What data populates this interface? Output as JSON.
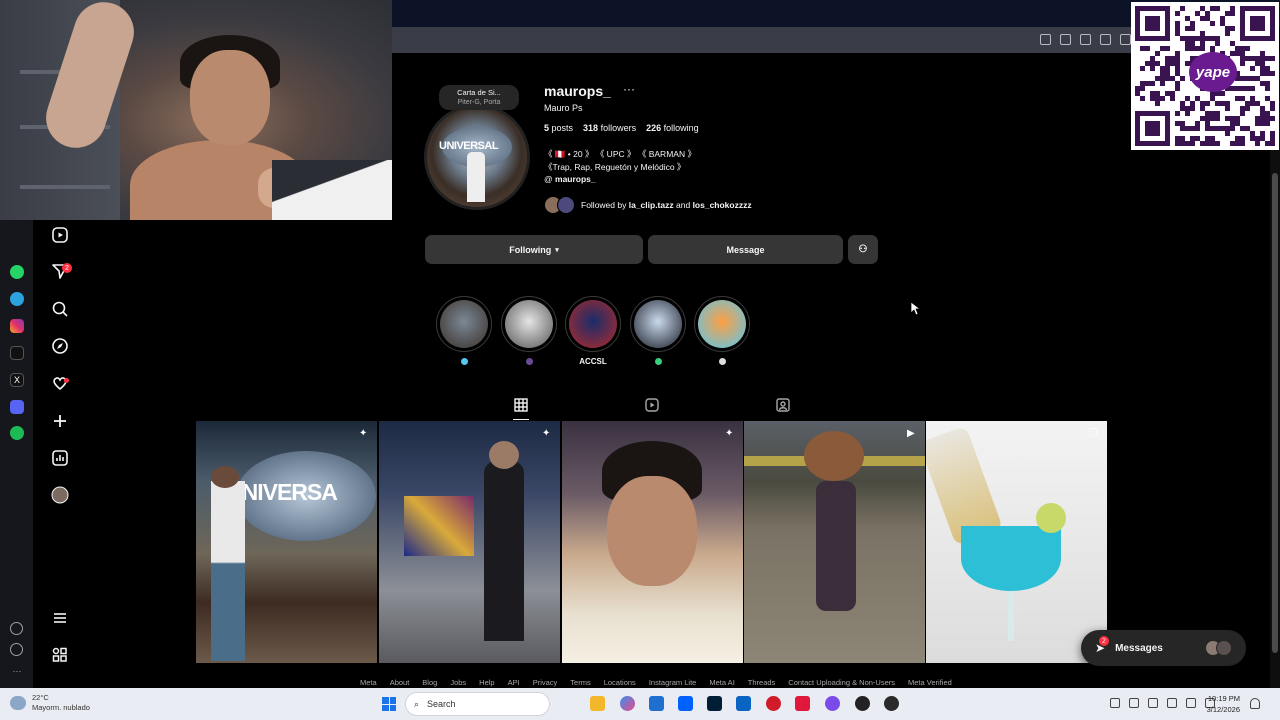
{
  "profile": {
    "username": "maurops_",
    "more": "···",
    "full_name": "Mauro Ps",
    "note_title": "Carta de Si...",
    "note_sub": "Piter-G, Porta",
    "stats": {
      "posts_num": "5",
      "posts_label": "posts",
      "followers_num": "318",
      "followers_label": "followers",
      "following_num": "226",
      "following_label": "following"
    },
    "bio_line1": "《 🇵🇪 • 20 》 《 UPC 》 《 BARMAN 》",
    "bio_line2": "《Trap, Rap, Reguetón y Melódico 》",
    "bio_link": "maurops_",
    "followed_prefix": "Followed by",
    "followed_user1": "la_clip.tazz",
    "followed_and": "and",
    "followed_user2": "los_chokozzzz"
  },
  "actions": {
    "following": "Following",
    "message": "Message"
  },
  "highlights": [
    {
      "label": "",
      "colors": [
        "#7a8896",
        "#3a2f28"
      ]
    },
    {
      "label": "",
      "colors": [
        "#e5e5e5",
        "#555"
      ]
    },
    {
      "label": "ACCSL",
      "colors": [
        "#1a2c6a",
        "#b22a2a"
      ]
    },
    {
      "label": "",
      "colors": [
        "#c9d9ec",
        "#1b1f2a"
      ]
    },
    {
      "label": "",
      "colors": [
        "#ff9f43",
        "#54c8f0"
      ]
    }
  ],
  "footer": [
    "Meta",
    "About",
    "Blog",
    "Jobs",
    "Help",
    "API",
    "Privacy",
    "Terms",
    "Locations",
    "Instagram Lite",
    "Meta AI",
    "Threads",
    "Contact Uploading & Non-Users",
    "Meta Verified"
  ],
  "messages": {
    "label": "Messages",
    "badge": "2"
  },
  "sidebar": {
    "notif_badge": "2"
  },
  "taskbar": {
    "weather_temp": "22°C",
    "weather_desc": "Mayorm. nublado",
    "search": "Search",
    "time": "10:19 PM",
    "date": "3/12/2026"
  },
  "qr": {
    "brand": "yape"
  },
  "colors": {
    "accent": "#0095f6",
    "button": "#363636",
    "badge": "#ff3040"
  }
}
